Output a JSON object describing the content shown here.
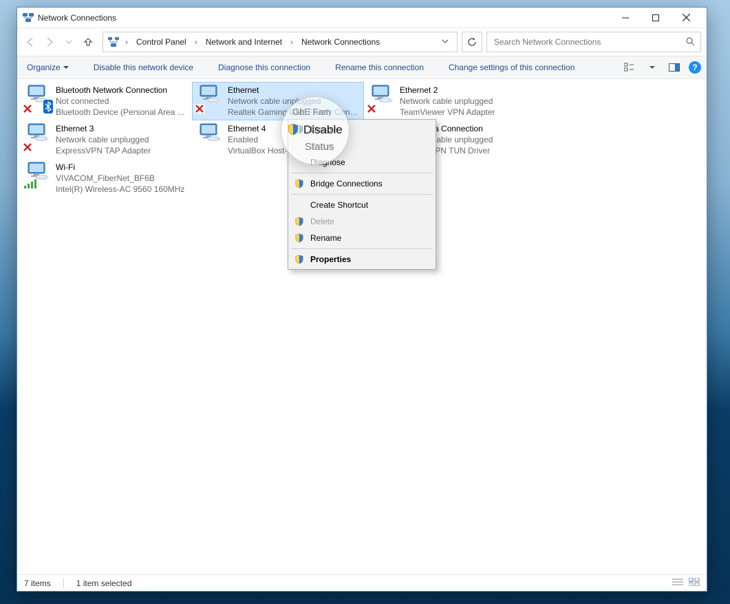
{
  "window": {
    "title": "Network Connections"
  },
  "breadcrumb": {
    "items": [
      "Control Panel",
      "Network and Internet",
      "Network Connections"
    ]
  },
  "search": {
    "placeholder": "Search Network Connections"
  },
  "commandbar": {
    "organize": "Organize",
    "items": [
      "Disable this network device",
      "Diagnose this connection",
      "Rename this connection",
      "Change settings of this connection"
    ]
  },
  "connections": [
    {
      "name": "Bluetooth Network Connection",
      "status": "Not connected",
      "device": "Bluetooth Device (Personal Area ...",
      "badges": [
        "x",
        "bt"
      ],
      "selected": false
    },
    {
      "name": "Ethernet",
      "status": "Network cable unplugged",
      "device": "Realtek Gaming GbE Family Contr...",
      "badges": [
        "x"
      ],
      "selected": true
    },
    {
      "name": "Ethernet 2",
      "status": "Network cable unplugged",
      "device": "TeamViewer VPN Adapter",
      "badges": [
        "x"
      ],
      "selected": false
    },
    {
      "name": "Ethernet 3",
      "status": "Network cable unplugged",
      "device": "ExpressVPN TAP Adapter",
      "badges": [
        "x"
      ],
      "selected": false
    },
    {
      "name": "Ethernet 4",
      "status": "Enabled",
      "device": "VirtualBox Host-Only Ethernet Ad...",
      "badges": [],
      "selected": false
    },
    {
      "name": "Local Area Connection",
      "status": "Network cable unplugged",
      "device": "ExpressVPN TUN Driver",
      "badges": [
        "x"
      ],
      "selected": false
    },
    {
      "name": "Wi-Fi",
      "status": "VIVACOM_FiberNet_BF6B",
      "device": "Intel(R) Wireless-AC 9560 160MHz",
      "badges": [
        "wifi"
      ],
      "selected": false
    }
  ],
  "contextmenu": {
    "items": [
      {
        "label": "Disable",
        "shield": true,
        "bold": false,
        "enabled": true
      },
      {
        "label": "Status",
        "shield": false,
        "bold": false,
        "enabled": false
      },
      {
        "label": "Diagnose",
        "shield": false,
        "bold": false,
        "enabled": true
      },
      {
        "sep": true
      },
      {
        "label": "Bridge Connections",
        "shield": true,
        "bold": false,
        "enabled": true
      },
      {
        "sep": true
      },
      {
        "label": "Create Shortcut",
        "shield": false,
        "bold": false,
        "enabled": true
      },
      {
        "label": "Delete",
        "shield": true,
        "bold": false,
        "enabled": false
      },
      {
        "label": "Rename",
        "shield": true,
        "bold": false,
        "enabled": true
      },
      {
        "sep": true
      },
      {
        "label": "Properties",
        "shield": true,
        "bold": true,
        "enabled": true
      }
    ]
  },
  "lens": {
    "top": "GbE Fam",
    "disable": "Disable",
    "status": "Status"
  },
  "statusbar": {
    "count": "7 items",
    "selection": "1 item selected"
  }
}
